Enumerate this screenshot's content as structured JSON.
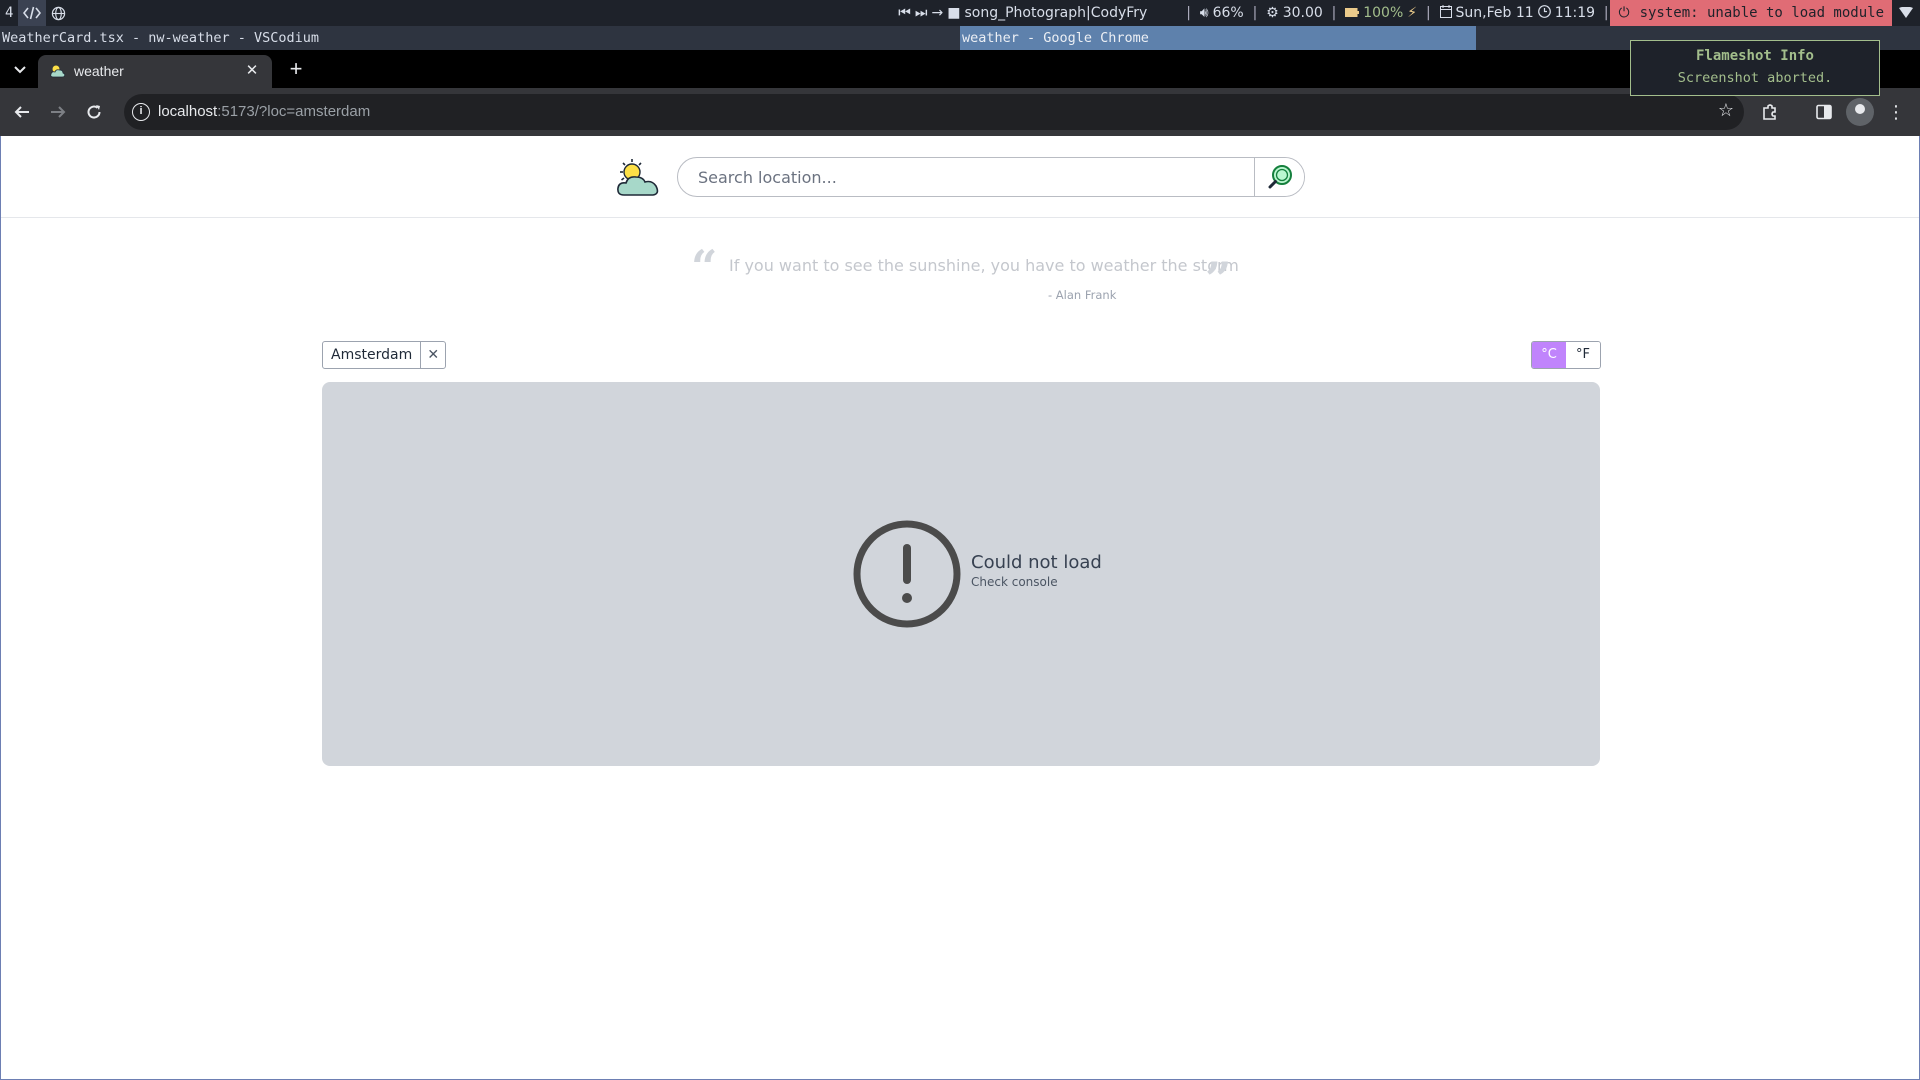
{
  "system_bar": {
    "workspace_number": "4",
    "media": {
      "track": "song_Photograph|CodyFry"
    },
    "volume": "66%",
    "cpu": "30.00",
    "battery": "100%",
    "date": "Sun,Feb 11",
    "time": "11:19",
    "error": "system: unable to load module"
  },
  "titlebar": {
    "left_title": "WeatherCard.tsx - nw-weather - VSCodium",
    "active_title": "weather - Google Chrome"
  },
  "notification": {
    "title": "Flameshot Info",
    "body": "Screenshot aborted."
  },
  "browser": {
    "tab": {
      "title": "weather"
    },
    "url": {
      "host": "localhost",
      "path": ":5173/?loc=amsterdam"
    }
  },
  "page": {
    "search": {
      "placeholder": "Search location..."
    },
    "quote": {
      "text": "If you want to see the sunshine, you have to weather the storm",
      "author": "- Alan Frank"
    },
    "location_chip": {
      "label": "Amsterdam",
      "remove": "✕"
    },
    "units": {
      "celsius": "°C",
      "fahrenheit": "°F",
      "selected": "celsius"
    },
    "error_card": {
      "title": "Could not load",
      "subtitle": "Check console"
    }
  },
  "colors": {
    "accent_toggle": "#c084fc",
    "card_bg": "#d1d5db",
    "error_banner": "#e06c75",
    "notify_green": "#a3be8c"
  }
}
